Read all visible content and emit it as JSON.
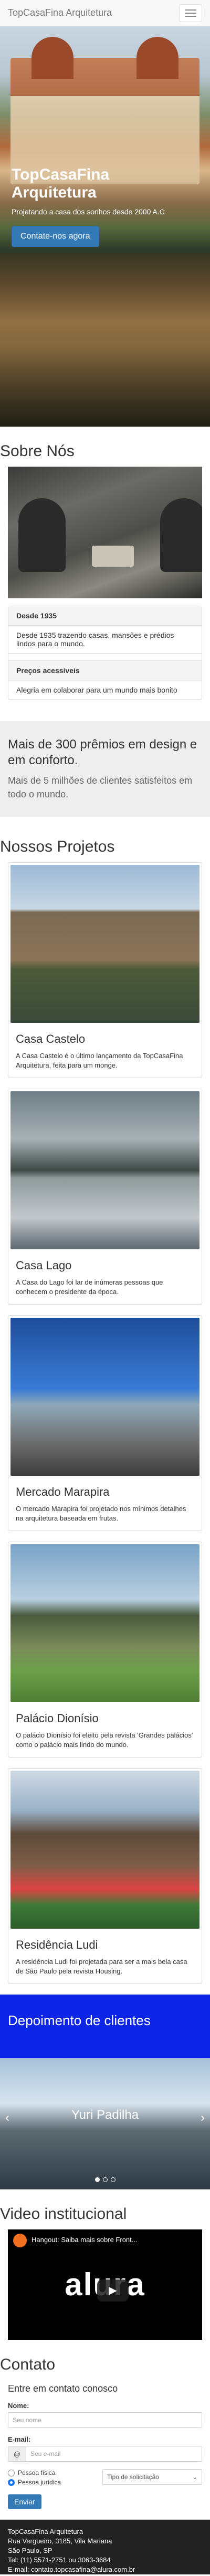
{
  "navbar": {
    "brand": "TopCasaFina Arquitetura"
  },
  "hero": {
    "title": "TopCasaFina Arquitetura",
    "subtitle": "Projetando a casa dos sonhos desde 2000 A.C",
    "cta": "Contate-nos agora"
  },
  "about": {
    "title": "Sobre Nós",
    "items": [
      {
        "heading": "Desde 1935",
        "text": "Desde 1935 trazendo casas, mansões e prédios lindos para o mundo."
      },
      {
        "heading": "Preços acessíveis",
        "text": "Alegria em colaborar para um mundo mais bonito"
      }
    ]
  },
  "jumbotron": {
    "title": "Mais de 300 prêmios em design e em conforto.",
    "text": "Mais de 5 milhões de clientes satisfeitos em todo o mundo."
  },
  "projects": {
    "title": "Nossos Projetos",
    "items": [
      {
        "name": "Casa Castelo",
        "text": "A Casa Castelo é o último lançamento da TopCasaFina Arquitetura, feita para um monge."
      },
      {
        "name": "Casa Lago",
        "text": "A Casa do Lago foi lar de inúmeras pessoas que conhecem o presidente da época."
      },
      {
        "name": "Mercado Marapira",
        "text": "O mercado Marapira foi projetado nos mínimos detalhes na arquitetura baseada em frutas."
      },
      {
        "name": "Palácio Dionísio",
        "text": "O palácio Dionísio foi eleito pela revista 'Grandes palácios' como o palácio mais lindo do mundo."
      },
      {
        "name": "Residência Ludi",
        "text": "A residência Ludi foi projetada para ser a mais bela casa de São Paulo pela revista Housing."
      }
    ]
  },
  "testimonials": {
    "title": "Depoimento de clientes",
    "slide_name": "Yuri Padilha",
    "prev": "‹",
    "next": "›"
  },
  "video": {
    "title": "Video institucional",
    "player_title": "Hangout: Saiba mais sobre Front...",
    "logo": "alura"
  },
  "contact": {
    "title": "Contato",
    "subtitle": "Entre em contato conosco",
    "name_label": "Nome:",
    "name_placeholder": "Seu nome",
    "email_label": "E-mail:",
    "email_addon": "@",
    "email_placeholder": "Seu e-mail",
    "radio_fisica": "Pessoa física",
    "radio_juridica": "Pessoa jurídica",
    "select_value": "Tipo de solicitação",
    "send": "Enviar"
  },
  "footer": {
    "line1": "TopCasaFina Arquitetura",
    "line2": "Rua Vergueiro, 3185, Vila Mariana",
    "line3": "São Paulo, SP",
    "line4": "Tel: (11) 5571-2751 ou 3063-3684",
    "line5": "E-mail: contato.topcasafina@alura.com.br"
  }
}
